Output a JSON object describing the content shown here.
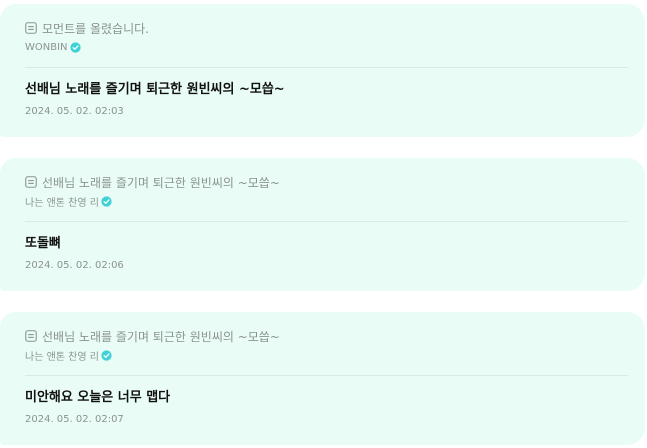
{
  "colors": {
    "card_background": "#e9fcf5",
    "verified_badge": "#3fd1d6",
    "muted_text": "#8b9390",
    "primary_text": "#111111"
  },
  "icons": {
    "reference": "document-icon",
    "verified": "verified-check-icon"
  },
  "comments": [
    {
      "reference": "모먼트를 올렸습니다.",
      "author": "WONBIN",
      "text": "선배님 노래를 즐기며 퇴근한 원빈씨의 ~모씁~",
      "timestamp": "2024. 05. 02. 02:03"
    },
    {
      "reference": "선배님 노래를 즐기며 퇴근한 원빈씨의 ~모씁~",
      "author": "나는 앤톤 찬영 리",
      "text": "또돌뼈",
      "timestamp": "2024. 05. 02. 02:06"
    },
    {
      "reference": "선배님 노래를 즐기며 퇴근한 원빈씨의 ~모씁~",
      "author": "나는 앤톤 찬영 리",
      "text": "미안해요 오늘은 너무 맵다",
      "timestamp": "2024. 05. 02. 02:07"
    }
  ]
}
